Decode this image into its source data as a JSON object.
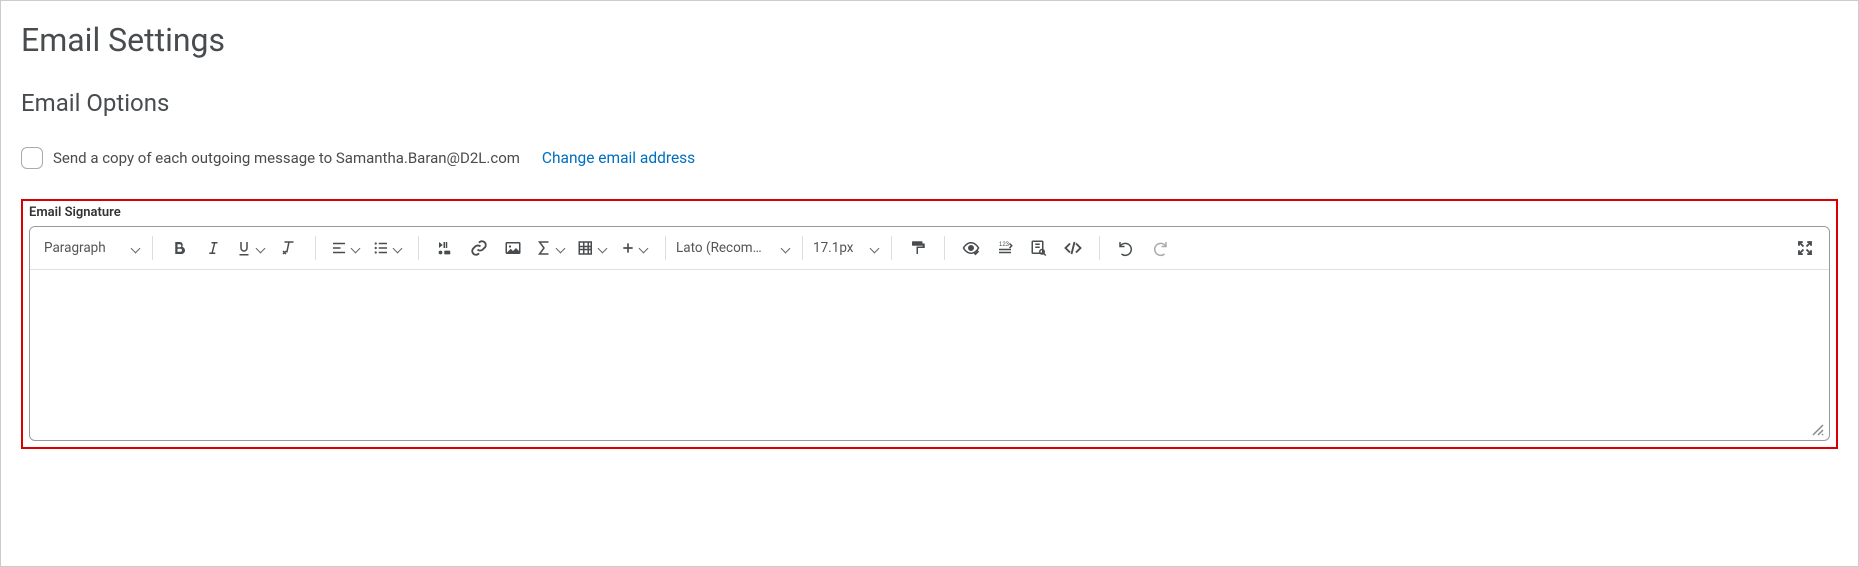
{
  "page_title": "Email Settings",
  "section_title": "Email Options",
  "option": {
    "label": "Send a copy of each outgoing message to Samantha.Baran@D2L.com",
    "checked": false
  },
  "change_link": "Change email address",
  "signature": {
    "label": "Email Signature",
    "toolbar": {
      "block_format": "Paragraph",
      "font_family": "Lato (Recomm…",
      "font_size": "17.1px"
    }
  }
}
